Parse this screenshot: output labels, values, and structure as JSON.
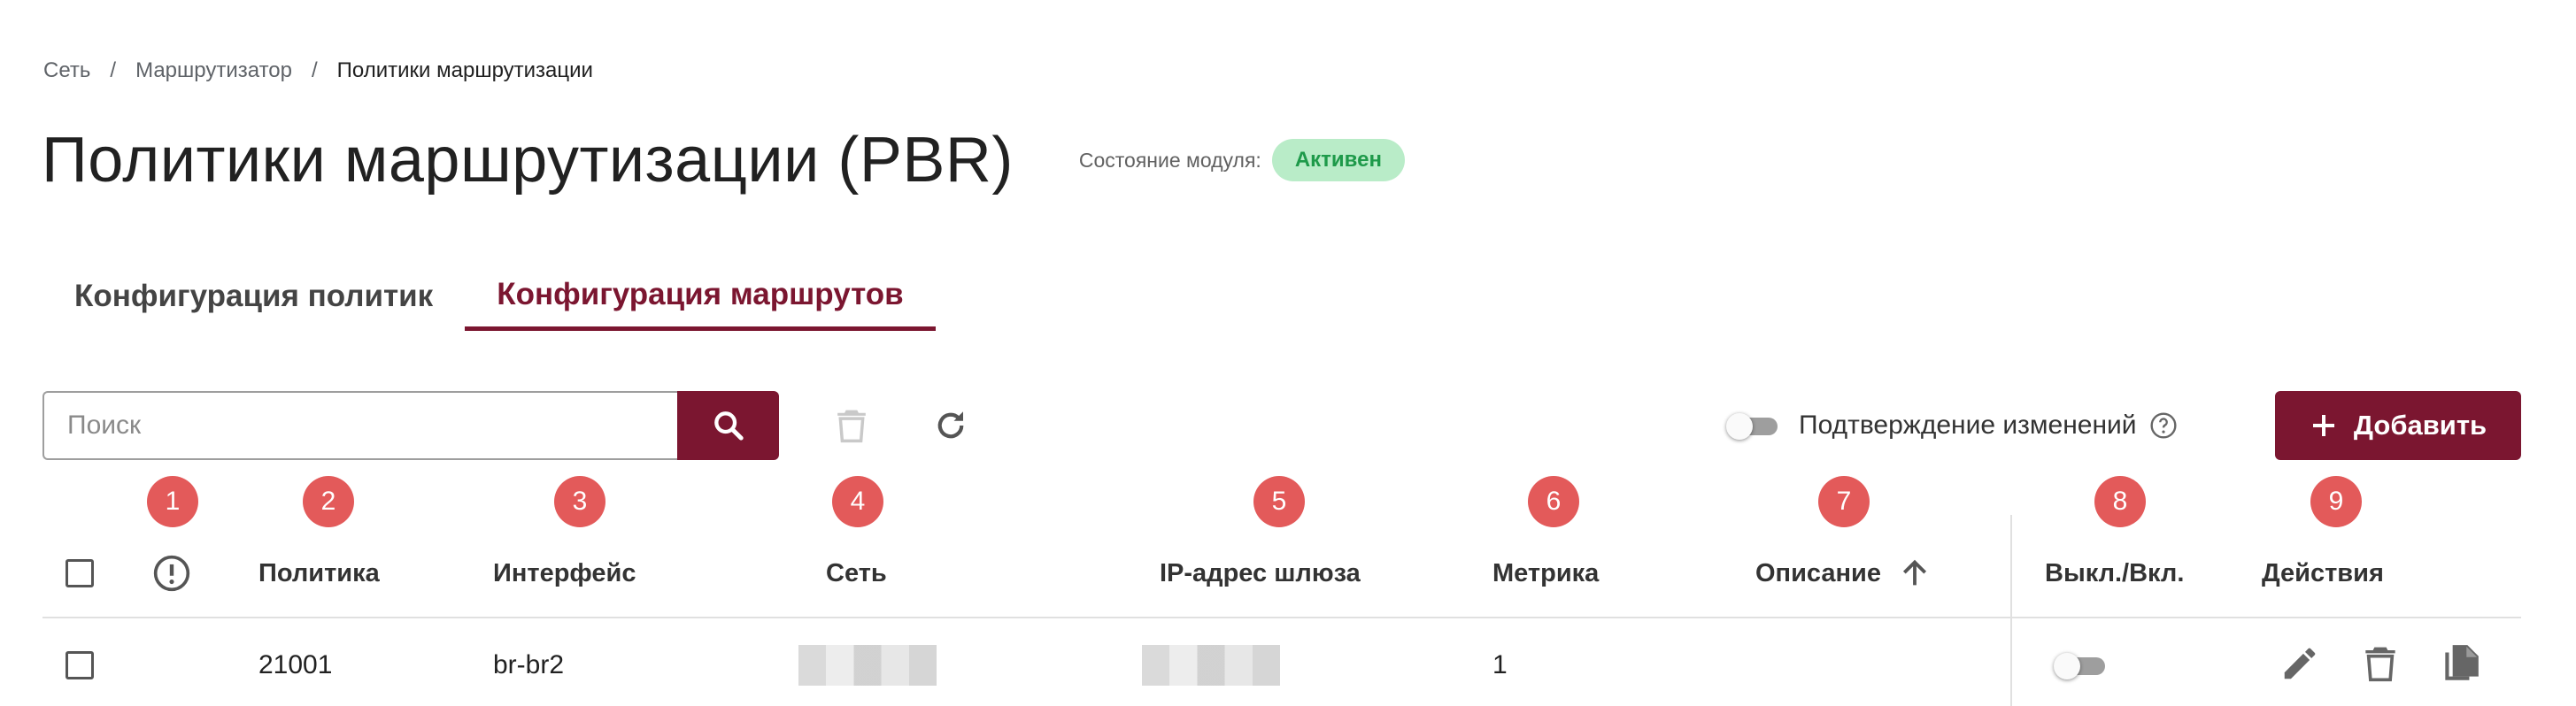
{
  "breadcrumb": {
    "item1": "Сеть",
    "item2": "Маршрутизатор",
    "current": "Политики маршрутизации",
    "separator": "/"
  },
  "page": {
    "title": "Политики маршрутизации (PBR)",
    "module_state_label": "Состояние модуля:",
    "module_state_value": "Активен"
  },
  "tabs": [
    {
      "label": "Конфигурация политик",
      "active": false
    },
    {
      "label": "Конфигурация маршрутов",
      "active": true
    }
  ],
  "toolbar": {
    "search_placeholder": "Поиск",
    "search_value": "",
    "confirm_label": "Подтверждение изменений",
    "confirm_enabled": false,
    "add_label": "Добавить",
    "icons": [
      "search-icon",
      "delete-icon",
      "refresh-icon",
      "help-icon",
      "plus-icon"
    ]
  },
  "markers": [
    "1",
    "2",
    "3",
    "4",
    "5",
    "6",
    "7",
    "8",
    "9"
  ],
  "table": {
    "columns": {
      "status": "",
      "policy": "Политика",
      "interface": "Интерфейс",
      "network": "Сеть",
      "gateway": "IP-адрес шлюза",
      "metric": "Метрика",
      "description": "Описание",
      "toggle": "Выкл./Вкл.",
      "actions": "Действия"
    },
    "sort": {
      "column": "description",
      "direction": "asc"
    },
    "rows": [
      {
        "policy": "21001",
        "interface": "br-br2",
        "network": "",
        "gateway": "",
        "metric": "1",
        "description": "",
        "enabled": false
      }
    ]
  },
  "colors": {
    "primary": "#7b1630",
    "badge_bg": "#b9ecc8",
    "badge_text": "#1e9a4a",
    "marker": "#e35a5a"
  }
}
